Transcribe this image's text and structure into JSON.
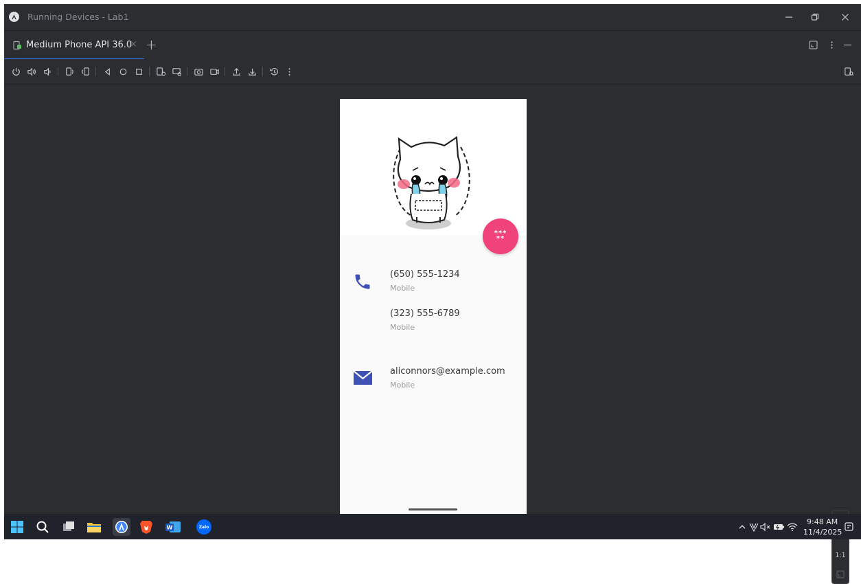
{
  "window": {
    "title": "Running Devices - Lab1"
  },
  "tabs": [
    {
      "label": "Medium Phone API 36.0",
      "close": "×"
    }
  ],
  "tab_add": "+",
  "zoom_panel": {
    "zoom_in": "+",
    "zoom_out": "—",
    "actual_size": "1:1"
  },
  "phone": {
    "fab_label": "***\n**",
    "fab_line1": "***",
    "fab_line2": "**",
    "contacts": {
      "phone1": {
        "number": "(650) 555-1234",
        "type": "Mobile"
      },
      "phone2": {
        "number": "(323) 555-6789",
        "type": "Mobile"
      },
      "email": {
        "address": "aliconnors@example.com",
        "type": "Mobile"
      }
    }
  },
  "taskbar": {
    "time": "9:48 AM",
    "date": "11/4/2025",
    "zalo_label": "Zalo",
    "word_label": "W"
  },
  "colors": {
    "accent_tab": "#3574f0",
    "fab": "#ef4379",
    "contact_icon": "#3f51b5"
  }
}
